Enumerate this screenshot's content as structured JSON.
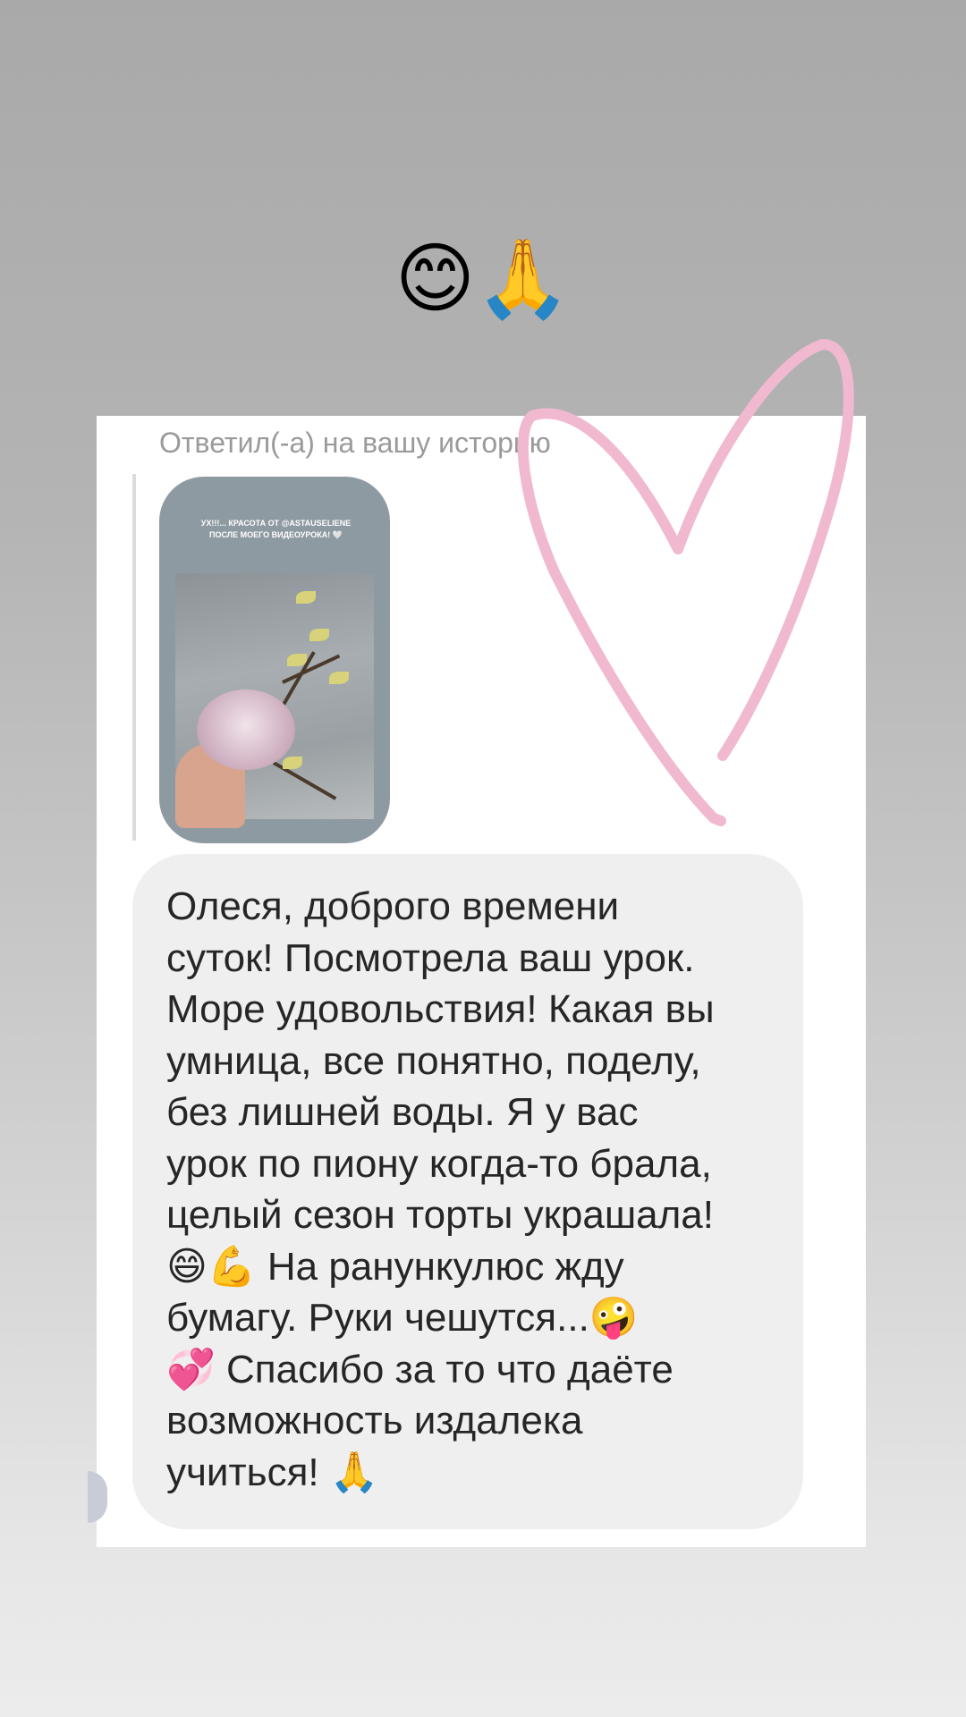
{
  "story": {
    "top_emojis": "😊🙏"
  },
  "dm": {
    "reply_label": "Ответил(-а) на вашу историю",
    "story_caption": "УХ!!!... КРАСОТА ОТ @ASTAUSELIENE ПОСЛЕ МОЕГО ВИДЕОУРОКА! 🤍",
    "message": "Олеся, доброго времени\nсуток! Посмотрела ваш урок.\nМоре удовольствия! Какая вы\nумница, все понятно, поделу,\nбез лишней воды. Я у вас\nурок по пиону когда-то брала,\nцелый сезон торты украшала!\n😄💪 На ранункулюс жду\nбумагу. Руки чешутся...🤪\n💞 Спасибо за то что даёте\nвозможность издалека\nучиться! 🙏"
  },
  "colors": {
    "heart_stroke": "#f0b9cf",
    "bubble_bg": "#efefef",
    "label_gray": "#9a9a9a"
  },
  "icons": {
    "decor": "heart-doodle"
  }
}
